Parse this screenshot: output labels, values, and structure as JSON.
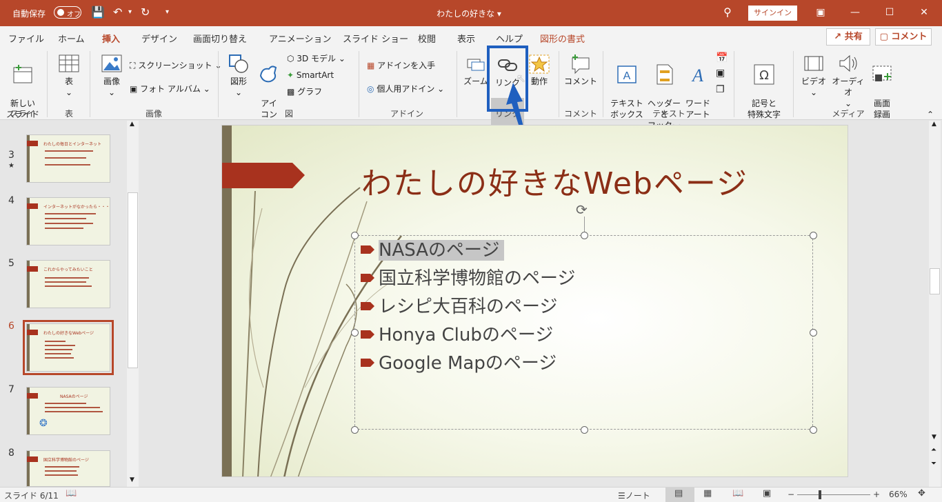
{
  "titlebar": {
    "autosave_label": "自動保存",
    "autosave_state": "オフ",
    "doc_title": "わたしの好きな ▾",
    "signin": "サインイン",
    "color": "#b7472a"
  },
  "tabs": [
    {
      "label": "ファイル"
    },
    {
      "label": "ホーム"
    },
    {
      "label": "挿入"
    },
    {
      "label": "デザイン"
    },
    {
      "label": "画面切り替え"
    },
    {
      "label": "アニメーション"
    },
    {
      "label": "スライド ショー"
    },
    {
      "label": "校閲"
    },
    {
      "label": "表示"
    },
    {
      "label": "ヘルプ"
    },
    {
      "label": "図形の書式"
    }
  ],
  "share_label": "共有",
  "comment_label": "コメント",
  "ribbon": {
    "new_slide": "新しい\nスライド",
    "table": "表",
    "image": "画像",
    "screenshot": "スクリーンショット",
    "photo_album": "フォト アルバム",
    "shapes": "図形",
    "icons": "アイ\nコン",
    "model3d": "3D モデル",
    "smartart": "SmartArt",
    "chart": "グラフ",
    "get_addins": "アドインを入手",
    "my_addins": "個人用アドイン",
    "zoom": "ズーム",
    "link": "リンク",
    "action": "動作",
    "comment": "コメント",
    "textbox": "テキスト\nボックス",
    "header_footer": "ヘッダーと\nフッター",
    "wordart": "ワード\nアート",
    "symbols": "記号と\n特殊文字",
    "video": "ビデオ",
    "audio": "オーディオ",
    "screen_record": "画面\n録画",
    "groups": {
      "slides": "スライド",
      "tables": "表",
      "images": "画像",
      "illustrations": "図",
      "addins": "アドイン",
      "links": "リンク",
      "comments": "コメント",
      "text": "テキスト",
      "media": "メディア"
    }
  },
  "thumbnails": [
    {
      "num": "3",
      "title": "わたしの毎日とインターネット",
      "star": "★"
    },
    {
      "num": "4",
      "title": "インターネットがなかったら・・・"
    },
    {
      "num": "5",
      "title": "これからやってみたいこと"
    },
    {
      "num": "6",
      "title": "わたしの好きなWebページ",
      "selected": true
    },
    {
      "num": "7",
      "title": "NASAのページ"
    },
    {
      "num": "8",
      "title": "国立科学博物館のページ"
    }
  ],
  "slide": {
    "title": "わたしの好きなWebページ",
    "bullets": [
      "NASAのページ",
      "国立科学博物館のページ",
      "レシピ大百科のページ",
      "Honya Clubのページ",
      "Google Mapのページ"
    ],
    "accent": "#a8321e"
  },
  "status": {
    "slide_info": "スライド 6/11",
    "notes": "ノート",
    "zoom": "66%"
  }
}
